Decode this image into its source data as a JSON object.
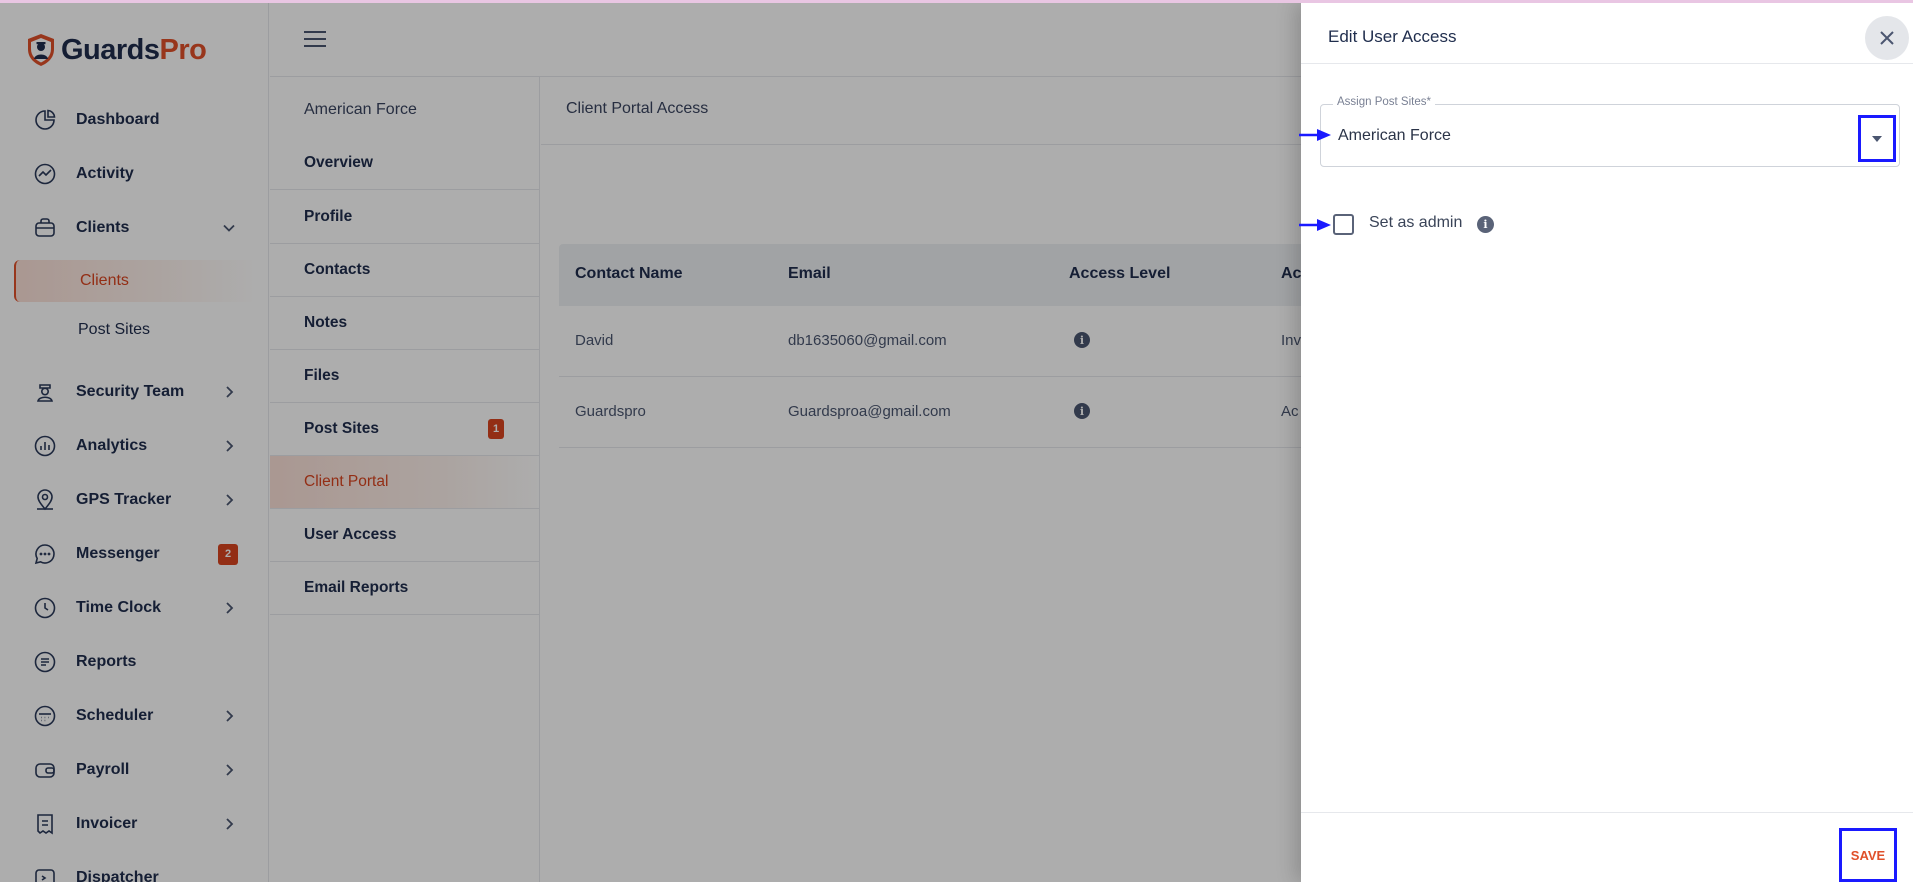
{
  "app": {
    "brand_first": "Guards",
    "brand_second": "Pro"
  },
  "sidebar": {
    "items": [
      {
        "label": "Dashboard",
        "icon": "pie-chart-icon"
      },
      {
        "label": "Activity",
        "icon": "activity-icon"
      },
      {
        "label": "Clients",
        "icon": "briefcase-icon",
        "expanded": true
      },
      {
        "label": "Security Team",
        "icon": "guard-icon"
      },
      {
        "label": "Analytics",
        "icon": "analytics-icon"
      },
      {
        "label": "GPS Tracker",
        "icon": "map-pin-icon"
      },
      {
        "label": "Messenger",
        "icon": "chat-icon",
        "badge": "2"
      },
      {
        "label": "Time Clock",
        "icon": "clock-icon"
      },
      {
        "label": "Reports",
        "icon": "report-icon"
      },
      {
        "label": "Scheduler",
        "icon": "calendar-icon"
      },
      {
        "label": "Payroll",
        "icon": "wallet-icon"
      },
      {
        "label": "Invoicer",
        "icon": "invoice-icon"
      },
      {
        "label": "Dispatcher",
        "icon": "dispatch-icon"
      }
    ],
    "clients_sub": [
      {
        "label": "Clients",
        "active": true
      },
      {
        "label": "Post Sites",
        "active": false
      }
    ]
  },
  "subnav": {
    "title": "American Force",
    "items": [
      {
        "label": "Overview"
      },
      {
        "label": "Profile"
      },
      {
        "label": "Contacts"
      },
      {
        "label": "Notes"
      },
      {
        "label": "Files"
      },
      {
        "label": "Post Sites",
        "badge": "1"
      },
      {
        "label": "Client Portal",
        "active": true
      },
      {
        "label": "User Access"
      },
      {
        "label": "Email Reports"
      }
    ]
  },
  "main": {
    "title": "Client Portal Access",
    "table": {
      "headers": [
        "Contact Name",
        "Email",
        "Access Level",
        "Ac"
      ],
      "rows": [
        {
          "name": "David",
          "email": "db1635060@gmail.com",
          "status": "Inv"
        },
        {
          "name": "Guardspro",
          "email": "Guardsproa@gmail.com",
          "status": "Ac"
        }
      ]
    }
  },
  "drawer": {
    "title": "Edit User Access",
    "assign_label": "Assign Post Sites*",
    "assign_value": "American Force",
    "admin_label": "Set as admin",
    "save_label": "SAVE"
  },
  "colors": {
    "brand_navy": "#1f2d4d",
    "brand_orange": "#e0502a",
    "highlight_blue": "#1a1aff"
  }
}
